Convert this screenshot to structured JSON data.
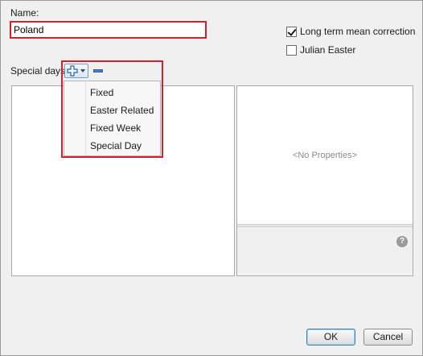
{
  "form": {
    "name_label": "Name:",
    "name_value": "Poland",
    "long_term_label": "Long term mean correction",
    "long_term_checked": true,
    "julian_label": "Julian Easter",
    "julian_checked": false,
    "special_days_label": "Special days"
  },
  "menu": {
    "items": [
      {
        "label": "Fixed"
      },
      {
        "label": "Easter Related"
      },
      {
        "label": "Fixed Week"
      },
      {
        "label": "Special Day"
      }
    ]
  },
  "properties": {
    "empty_text": "<No Properties>",
    "help_glyph": "?"
  },
  "buttons": {
    "ok_label": "OK",
    "cancel_label": "Cancel"
  },
  "icons": {
    "add": "plus-icon",
    "dropdown": "caret-down-icon",
    "remove": "minus-icon",
    "help": "help-icon"
  },
  "colors": {
    "highlight": "#d61f2a",
    "plus": "#3b78c4"
  }
}
